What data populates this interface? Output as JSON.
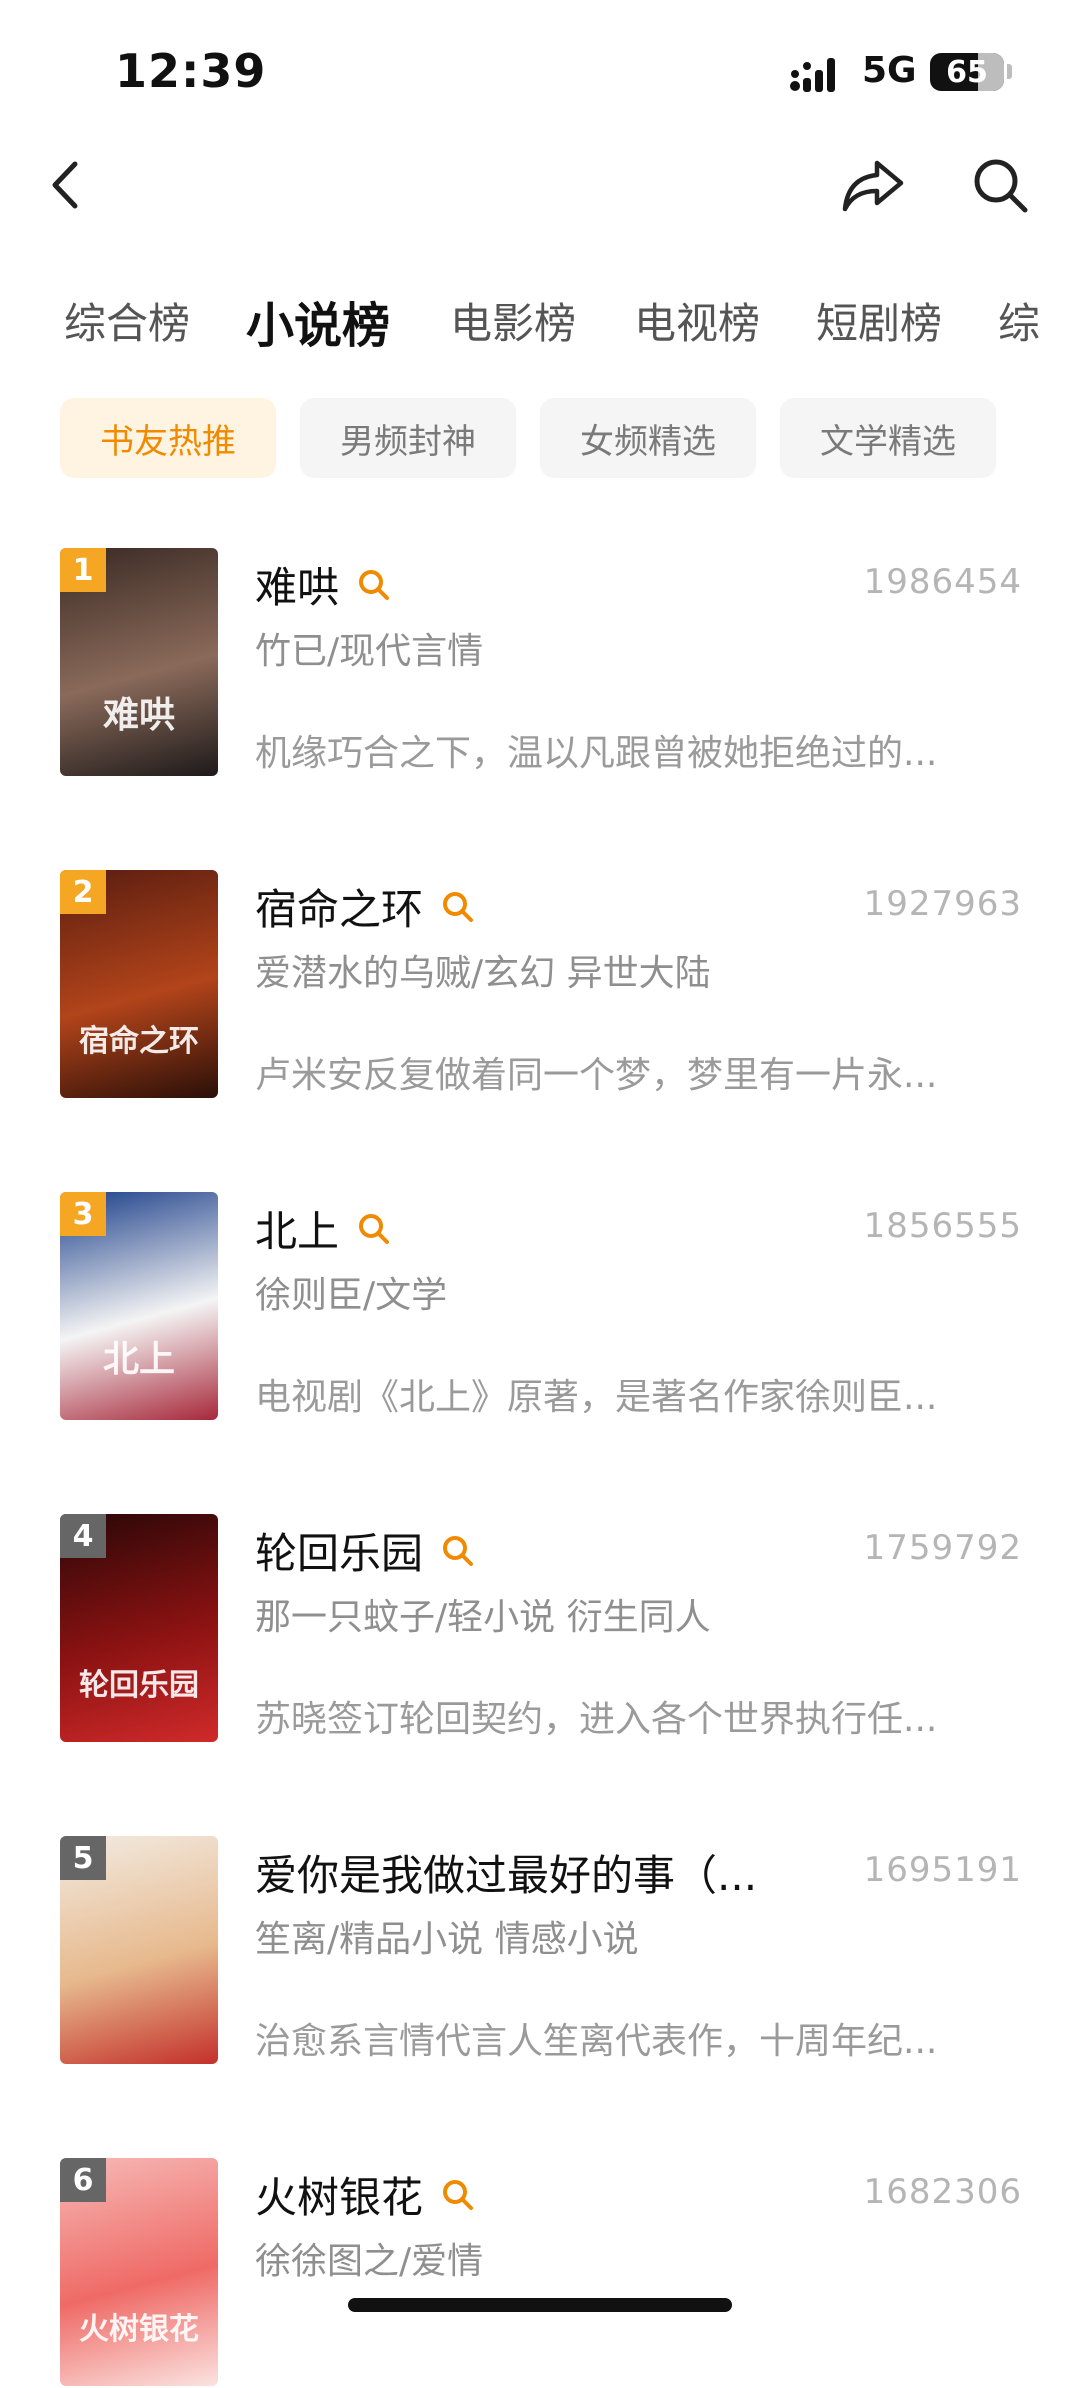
{
  "status_bar": {
    "time": "12:39",
    "network": "5G",
    "battery": "65",
    "battery_level": 0.65
  },
  "nav": {
    "back_icon": "chevron-left-icon",
    "share_icon": "share-icon",
    "search_icon": "search-icon"
  },
  "tabs": [
    {
      "label": "综合榜",
      "active": false
    },
    {
      "label": "小说榜",
      "active": true
    },
    {
      "label": "电影榜",
      "active": false
    },
    {
      "label": "电视榜",
      "active": false
    },
    {
      "label": "短剧榜",
      "active": false
    },
    {
      "label": "综",
      "active": false
    }
  ],
  "chips": [
    {
      "label": "书友热推",
      "active": true
    },
    {
      "label": "男频封神",
      "active": false
    },
    {
      "label": "女频精选",
      "active": false
    },
    {
      "label": "文学精选",
      "active": false
    }
  ],
  "colors": {
    "accent": "#f08a00",
    "rank_top": "#f5a623",
    "rank_other": "#666666"
  },
  "books": [
    {
      "rank": "1",
      "title": "难哄",
      "count": "1986454",
      "meta": "竹已/现代言情",
      "desc": "机缘巧合之下，温以凡跟曾被她拒绝过的...",
      "cover_colors": [
        "#3a2a24",
        "#8a6a5a",
        "#1e1a1a"
      ],
      "cover_text": "难哄"
    },
    {
      "rank": "2",
      "title": "宿命之环",
      "count": "1927963",
      "meta": "爱潜水的乌贼/玄幻 异世大陆",
      "desc": "卢米安反复做着同一个梦，梦里有一片永...",
      "cover_colors": [
        "#5a1d10",
        "#b2441a",
        "#2a0f08"
      ],
      "cover_text": "宿命之环"
    },
    {
      "rank": "3",
      "title": "北上",
      "count": "1856555",
      "meta": "徐则臣/文学",
      "desc": "电视剧《北上》原著，是著名作家徐则臣...",
      "cover_colors": [
        "#1c3f8a",
        "#f4f4f4",
        "#a7283a"
      ],
      "cover_text": "北上"
    },
    {
      "rank": "4",
      "title": "轮回乐园",
      "count": "1759792",
      "meta": "那一只蚊子/轻小说 衍生同人",
      "desc": "苏晓签订轮回契约，进入各个世界执行任...",
      "cover_colors": [
        "#2a0707",
        "#8c1212",
        "#d02a2a"
      ],
      "cover_text": "轮回乐园"
    },
    {
      "rank": "5",
      "title": "爱你是我做过最好的事（...",
      "count": "1695191",
      "meta": "笙离/精品小说 情感小说",
      "desc": "治愈系言情代言人笙离代表作，十周年纪...",
      "cover_colors": [
        "#f2ebe2",
        "#e7b98d",
        "#c3302a"
      ],
      "cover_text": ""
    },
    {
      "rank": "6",
      "title": "火树银花",
      "count": "1682306",
      "meta": "徐徐图之/爱情",
      "desc": "",
      "cover_colors": [
        "#f6b9b6",
        "#ef6a66",
        "#fbe3e0"
      ],
      "cover_text": "火树银花"
    }
  ]
}
